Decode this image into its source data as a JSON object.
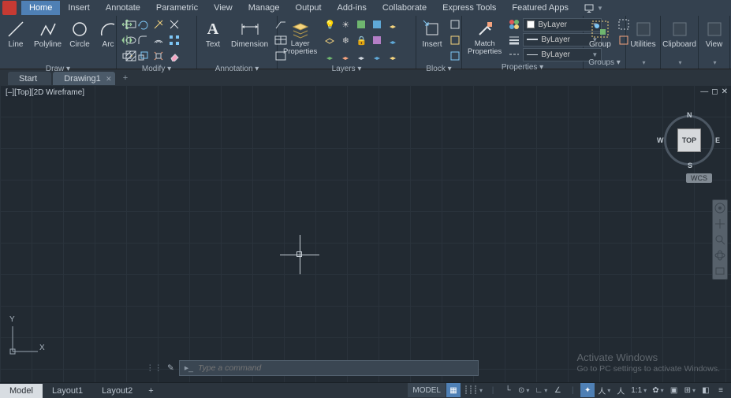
{
  "ribbonTabs": [
    "Home",
    "Insert",
    "Annotate",
    "Parametric",
    "View",
    "Manage",
    "Output",
    "Add-ins",
    "Collaborate",
    "Express Tools",
    "Featured Apps"
  ],
  "activeRibbonTab": 0,
  "panels": {
    "draw": {
      "title": "Draw ▾",
      "line": "Line",
      "polyline": "Polyline",
      "circle": "Circle",
      "arc": "Arc"
    },
    "modify": {
      "title": "Modify ▾"
    },
    "annotation": {
      "title": "Annotation ▾",
      "text": "Text",
      "dimension": "Dimension"
    },
    "layers": {
      "title": "Layers ▾",
      "layerProps": "Layer\nProperties"
    },
    "block": {
      "title": "Block ▾",
      "insert": "Insert"
    },
    "properties": {
      "title": "Properties ▾",
      "match": "Match\nProperties",
      "byLayer1": "ByLayer",
      "byLayer2": "ByLayer",
      "byLayer3": "ByLayer"
    },
    "groups": {
      "title": "Groups ▾",
      "group": "Group"
    },
    "utilities": {
      "title": "Utilities",
      "label": "Utilities"
    },
    "clipboard": {
      "title": "Clipboard",
      "label": "Clipboard"
    },
    "view": {
      "title": "View",
      "label": "View"
    }
  },
  "fileTabs": [
    {
      "label": "Start",
      "active": false
    },
    {
      "label": "Drawing1",
      "active": true
    }
  ],
  "viewLabel": "[–][Top][2D Wireframe]",
  "viewcube": {
    "face": "TOP",
    "n": "N",
    "s": "S",
    "e": "E",
    "w": "W"
  },
  "wcs": "WCS",
  "ucs": {
    "x": "X",
    "y": "Y"
  },
  "cmd": {
    "placeholder": "Type a command"
  },
  "watermark": {
    "l1": "Activate Windows",
    "l2": "Go to PC settings to activate Windows."
  },
  "bottomTabs": [
    "Model",
    "Layout1",
    "Layout2"
  ],
  "activeBottomTab": 0,
  "status": {
    "model": "MODEL",
    "ratio": "1:1"
  }
}
